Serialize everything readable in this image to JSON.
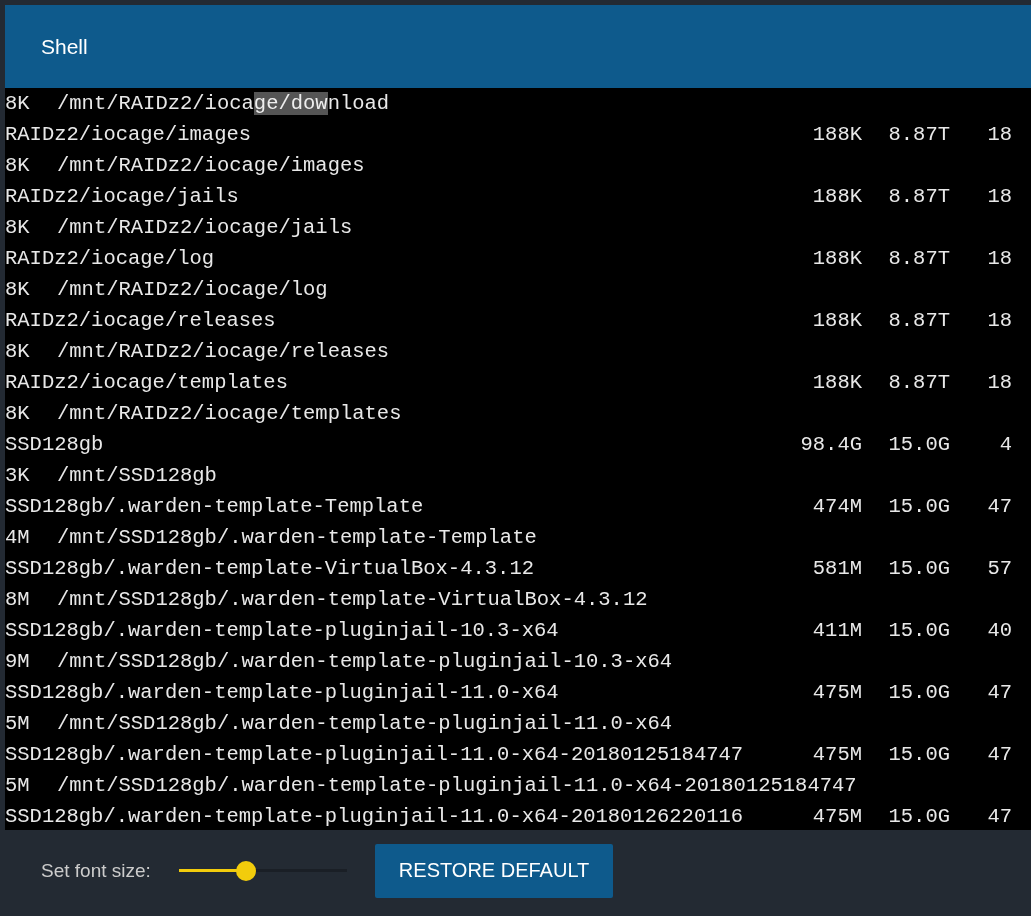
{
  "window": {
    "title": "Shell"
  },
  "terminal": {
    "lines": [
      {
        "kind": "mount",
        "size": "8K",
        "segments": [
          {
            "text": "/mnt/RAIDz2/ioca",
            "selected": false
          },
          {
            "text": "ge/dow",
            "selected": true
          },
          {
            "text": "nload",
            "selected": false
          }
        ]
      },
      {
        "kind": "dataset",
        "name": "RAIDz2/iocage/images",
        "used": "188K",
        "avail": "8.87T",
        "refer": "18"
      },
      {
        "kind": "mount",
        "size": "8K",
        "segments": [
          {
            "text": "/mnt/RAIDz2/iocage/images",
            "selected": false
          }
        ]
      },
      {
        "kind": "dataset",
        "name": "RAIDz2/iocage/jails",
        "used": "188K",
        "avail": "8.87T",
        "refer": "18"
      },
      {
        "kind": "mount",
        "size": "8K",
        "segments": [
          {
            "text": "/mnt/RAIDz2/iocage/jails",
            "selected": false
          }
        ]
      },
      {
        "kind": "dataset",
        "name": "RAIDz2/iocage/log",
        "used": "188K",
        "avail": "8.87T",
        "refer": "18"
      },
      {
        "kind": "mount",
        "size": "8K",
        "segments": [
          {
            "text": "/mnt/RAIDz2/iocage/log",
            "selected": false
          }
        ]
      },
      {
        "kind": "dataset",
        "name": "RAIDz2/iocage/releases",
        "used": "188K",
        "avail": "8.87T",
        "refer": "18"
      },
      {
        "kind": "mount",
        "size": "8K",
        "segments": [
          {
            "text": "/mnt/RAIDz2/iocage/releases",
            "selected": false
          }
        ]
      },
      {
        "kind": "dataset",
        "name": "RAIDz2/iocage/templates",
        "used": "188K",
        "avail": "8.87T",
        "refer": "18"
      },
      {
        "kind": "mount",
        "size": "8K",
        "segments": [
          {
            "text": "/mnt/RAIDz2/iocage/templates",
            "selected": false
          }
        ]
      },
      {
        "kind": "dataset",
        "name": "SSD128gb",
        "used": "98.4G",
        "avail": "15.0G",
        "refer": "4"
      },
      {
        "kind": "mount",
        "size": "3K",
        "segments": [
          {
            "text": "/mnt/SSD128gb",
            "selected": false
          }
        ]
      },
      {
        "kind": "dataset",
        "name": "SSD128gb/.warden-template-Template",
        "used": "474M",
        "avail": "15.0G",
        "refer": "47"
      },
      {
        "kind": "mount",
        "size": "4M",
        "segments": [
          {
            "text": "/mnt/SSD128gb/.warden-template-Template",
            "selected": false
          }
        ]
      },
      {
        "kind": "dataset",
        "name": "SSD128gb/.warden-template-VirtualBox-4.3.12",
        "used": "581M",
        "avail": "15.0G",
        "refer": "57"
      },
      {
        "kind": "mount",
        "size": "8M",
        "segments": [
          {
            "text": "/mnt/SSD128gb/.warden-template-VirtualBox-4.3.12",
            "selected": false
          }
        ]
      },
      {
        "kind": "dataset",
        "name": "SSD128gb/.warden-template-pluginjail-10.3-x64",
        "used": "411M",
        "avail": "15.0G",
        "refer": "40"
      },
      {
        "kind": "mount",
        "size": "9M",
        "segments": [
          {
            "text": "/mnt/SSD128gb/.warden-template-pluginjail-10.3-x64",
            "selected": false
          }
        ]
      },
      {
        "kind": "dataset",
        "name": "SSD128gb/.warden-template-pluginjail-11.0-x64",
        "used": "475M",
        "avail": "15.0G",
        "refer": "47"
      },
      {
        "kind": "mount",
        "size": "5M",
        "segments": [
          {
            "text": "/mnt/SSD128gb/.warden-template-pluginjail-11.0-x64",
            "selected": false
          }
        ]
      },
      {
        "kind": "dataset",
        "name": "SSD128gb/.warden-template-pluginjail-11.0-x64-20180125184747",
        "used": "475M",
        "avail": "15.0G",
        "refer": "47"
      },
      {
        "kind": "mount",
        "size": "5M",
        "segments": [
          {
            "text": "/mnt/SSD128gb/.warden-template-pluginjail-11.0-x64-20180125184747",
            "selected": false
          }
        ]
      },
      {
        "kind": "dataset",
        "name": "SSD128gb/.warden-template-pluginjail-11.0-x64-20180126220116",
        "used": "475M",
        "avail": "15.0G",
        "refer": "47"
      }
    ]
  },
  "font_size": {
    "label": "Set font size:",
    "level": 0.4
  },
  "restore_button": "RESTORE DEFAULT"
}
